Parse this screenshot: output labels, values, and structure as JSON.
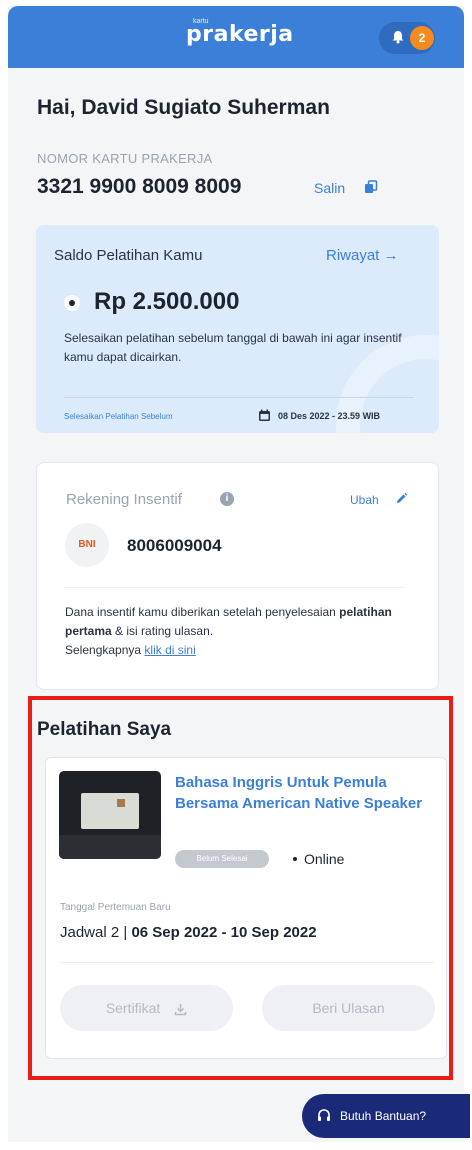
{
  "header": {
    "logo_small": "kartu",
    "logo": "prakerja",
    "notif_count": "2"
  },
  "profile": {
    "greeting": "Hai, David Sugiato Suherman",
    "card_label": "NOMOR KARTU PRAKERJA",
    "card_number": "3321 9900 8009 8009",
    "copy_label": "Salin"
  },
  "saldo": {
    "title": "Saldo Pelatihan Kamu",
    "history_label": "Riwayat →",
    "amount": "Rp 2.500.000",
    "description": "Selesaikan pelatihan sebelum tanggal di bawah ini agar insentif kamu dapat dicairkan.",
    "deadline_label": "Selesaikan Pelatihan Sebelum",
    "deadline_value": "08 Des 2022 - 23.59 WIB"
  },
  "rekening": {
    "title": "Rekening Insentif",
    "edit_label": "Ubah",
    "bank_logo": "BNI",
    "account_number": "8006009004",
    "desc_part1": "Dana insentif kamu diberikan setelah penyelesaian ",
    "desc_bold": "pelatihan pertama",
    "desc_part2": " & isi rating ulasan.",
    "more_prefix": "Selengkapnya ",
    "more_link": "klik di sini"
  },
  "pelatihan": {
    "section_title": "Pelatihan Saya",
    "course_title": "Bahasa Inggris Untuk Pemula Bersama American Native Speaker",
    "status": "Belum Selesai",
    "mode": "Online",
    "schedule_label": "Tanggal Pertemuan Baru",
    "schedule_prefix": "Jadwal 2 | ",
    "schedule_dates": "06 Sep 2022 - 10 Sep 2022",
    "certificate_label": "Sertifikat",
    "review_label": "Beri Ulasan"
  },
  "help": {
    "label": "Butuh Bantuan?"
  },
  "colors": {
    "primary": "#3c7fd8",
    "badge": "#f58b1f",
    "highlight": "#e81e14",
    "help_bg": "#1b2a78"
  }
}
